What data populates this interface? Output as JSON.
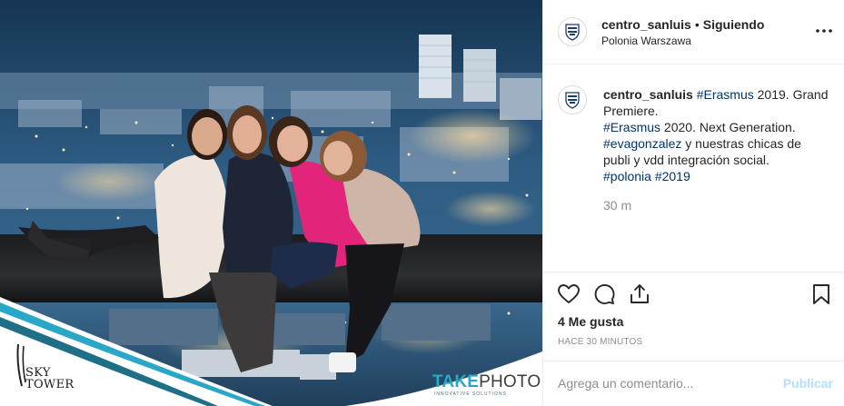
{
  "photo": {
    "alt_brand_left": [
      "SKY",
      "TOWER"
    ],
    "brand_right_main": "TAKE",
    "brand_right_accent": "PHOTO",
    "brand_right_sub": "INNOVATIVE SOLUTIONS",
    "accent_color": "#2aa7c7"
  },
  "header": {
    "username": "centro_sanluis",
    "separator": "•",
    "follow_state": "Siguiendo",
    "location": "Polonia Warszawa",
    "more_icon": "more-horizontal-icon"
  },
  "caption": {
    "username": "centro_sanluis",
    "segments": [
      {
        "type": "tag",
        "text": "#Erasmus"
      },
      {
        "type": "text",
        "text": " 2019. Grand Premiere."
      },
      {
        "type": "br"
      },
      {
        "type": "tag",
        "text": "#Erasmus"
      },
      {
        "type": "text",
        "text": " 2020. Next Generation."
      },
      {
        "type": "br"
      },
      {
        "type": "tag",
        "text": "#evagonzalez"
      },
      {
        "type": "text",
        "text": " y nuestras chicas de publi y vdd integración social."
      },
      {
        "type": "br"
      },
      {
        "type": "tag",
        "text": "#polonia"
      },
      {
        "type": "text",
        "text": " "
      },
      {
        "type": "tag",
        "text": "#2019"
      }
    ],
    "age": "30 m"
  },
  "actions": {
    "like_icon": "heart-icon",
    "comment_icon": "comment-icon",
    "share_icon": "share-icon",
    "save_icon": "bookmark-icon"
  },
  "likes": "4 Me gusta",
  "time": "HACE 30 MINUTOS",
  "comment": {
    "placeholder": "Agrega un comentario...",
    "publish_label": "Publicar",
    "publish_color": "#b2dffc"
  },
  "colors": {
    "tag": "#003569",
    "muted": "#8e8e8e",
    "border": "#efefef"
  }
}
